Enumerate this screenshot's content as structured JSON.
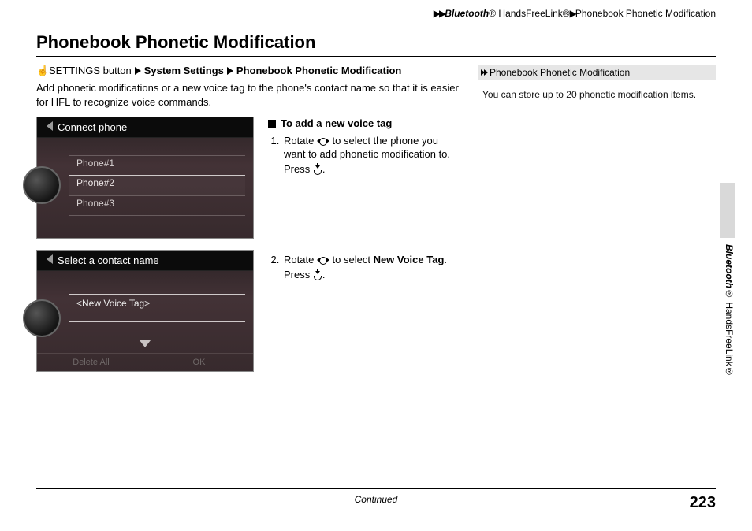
{
  "breadcrumb": {
    "arrows": "▶▶",
    "bluetooth": "Bluetooth",
    "reg": "®",
    "handsfree": " HandsFreeLink®",
    "sep": "▶",
    "current": "Phonebook Phonetic Modification"
  },
  "title": "Phonebook Phonetic Modification",
  "nav": {
    "settings_label": "SETTINGS button",
    "system_settings": "System Settings",
    "current": "Phonebook Phonetic Modification"
  },
  "intro": "Add phonetic modifications or a new voice tag to the phone's contact name so that it is easier for HFL to recognize voice commands.",
  "screen1": {
    "title": "Connect phone",
    "items": [
      "Phone#1",
      "Phone#2",
      "Phone#3"
    ],
    "selected_index": 1
  },
  "screen2": {
    "title": "Select a contact name",
    "item": "<New Voice Tag>",
    "footer_left": "Delete All",
    "footer_right": "OK"
  },
  "instr": {
    "heading": "To add a new voice tag",
    "step1_a": "Rotate ",
    "step1_b": " to select the phone you want to add phonetic modification to. Press ",
    "step1_c": ".",
    "step2_a": "Rotate ",
    "step2_b": " to select ",
    "step2_bold": "New Voice Tag",
    "step2_c": ". Press ",
    "step2_d": "."
  },
  "sidebar": {
    "title": "Phonebook Phonetic Modification",
    "body": "You can store up to 20 phonetic modification items."
  },
  "side_label": {
    "bluetooth": "Bluetooth",
    "reg": "®",
    "rest": " HandsFreeLink®"
  },
  "footer": {
    "continued": "Continued",
    "page": "223"
  }
}
